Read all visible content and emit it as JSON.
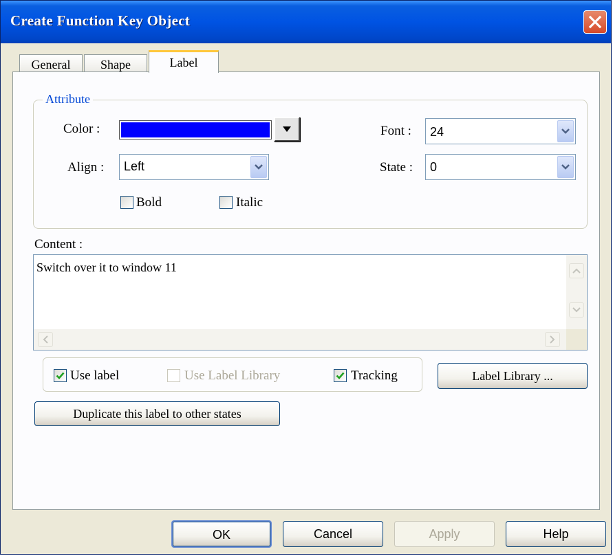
{
  "window": {
    "title": "Create Function Key Object"
  },
  "tabs": [
    {
      "label": "General"
    },
    {
      "label": "Shape"
    },
    {
      "label": "Label"
    }
  ],
  "attribute": {
    "title": "Attribute",
    "color_label": "Color :",
    "color_value": "#0000ff",
    "align_label": "Align :",
    "align_value": "Left",
    "font_label": "Font :",
    "font_value": "24",
    "state_label": "State :",
    "state_value": "0",
    "bold_label": "Bold",
    "bold_checked": false,
    "italic_label": "Italic",
    "italic_checked": false
  },
  "content": {
    "label": "Content :",
    "text": "Switch over it to window 11"
  },
  "options": {
    "use_label": "Use label",
    "use_label_checked": true,
    "use_label_library": "Use Label Library",
    "use_label_library_checked": false,
    "tracking": "Tracking",
    "tracking_checked": true,
    "label_library_button": "Label Library ...",
    "duplicate_button": "Duplicate this label to other states"
  },
  "footer": {
    "ok": "OK",
    "cancel": "Cancel",
    "apply": "Apply",
    "help": "Help"
  }
}
